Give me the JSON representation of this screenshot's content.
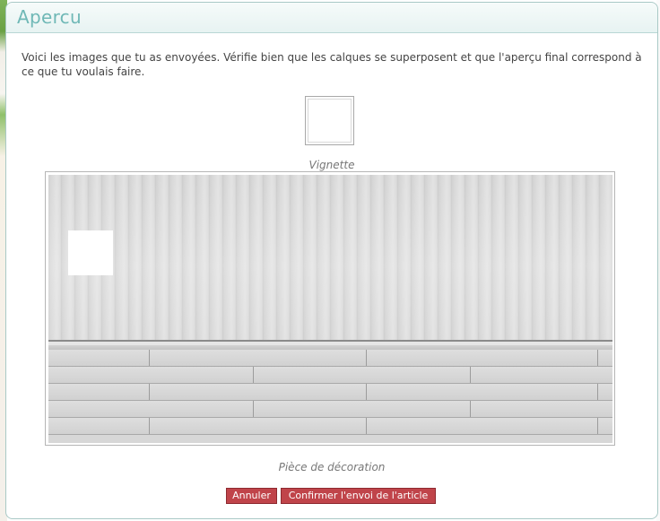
{
  "dialog": {
    "title": "Apercu",
    "intro": "Voici les images que tu as envoyées. Vérifie bien que les calques se superposent et que l'aperçu final correspond à ce que tu voulais faire.",
    "thumbnail_caption": "Vignette",
    "room_caption": "Pièce de décoration",
    "buttons": {
      "cancel": "Annuler",
      "confirm": "Confirmer l'envoi de l'article"
    }
  },
  "colors": {
    "title_text": "#6fb8b6",
    "button_bg": "#c0444a"
  }
}
